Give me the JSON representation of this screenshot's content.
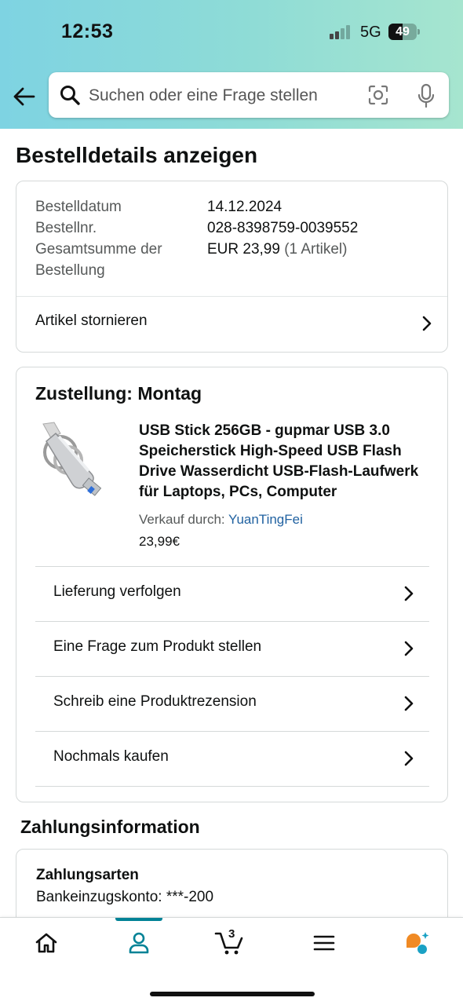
{
  "status_bar": {
    "time": "12:53",
    "network": "5G",
    "battery": "49",
    "battery_level": 0.49
  },
  "search": {
    "placeholder": "Suchen oder eine Frage stellen"
  },
  "page_title": "Bestelldetails anzeigen",
  "order_summary": {
    "date_label": "Bestelldatum",
    "date_value": "14.12.2024",
    "number_label": "Bestellnr.",
    "number_value": "028-8398759-0039552",
    "total_label": "Gesamtsumme der Bestellung",
    "total_value": "EUR 23,99",
    "total_count": "(1 Artikel)",
    "cancel_label": "Artikel stornieren"
  },
  "delivery": {
    "title": "Zustellung: Montag",
    "product_title": "USB Stick 256GB - gupmar USB 3.0 Speicherstick High-Speed USB Flash Drive Wasserdicht USB-Flash-Laufwerk für Laptops, PCs, Computer",
    "seller_prefix": "Verkauf durch: ",
    "seller_name": "YuanTingFei",
    "price": "23,99€",
    "actions": [
      {
        "label": "Lieferung verfolgen"
      },
      {
        "label": "Eine Frage zum Produkt stellen"
      },
      {
        "label": "Schreib eine Produktrezension"
      },
      {
        "label": "Nochmals kaufen"
      }
    ]
  },
  "payment": {
    "section_title": "Zahlungsinformation",
    "method_label": "Zahlungsarten",
    "method_value": "Bankeinzugskonto: ***-200"
  },
  "tabbar": {
    "cart_count": "3",
    "active_tab": "account",
    "accent_color": "#008296"
  },
  "colors": {
    "header_gradient_start": "#7ed3e2",
    "header_gradient_end": "#a6e5cf",
    "link": "#2162a1",
    "assistant_orange": "#f08a24",
    "assistant_teal": "#1aa1c4"
  }
}
